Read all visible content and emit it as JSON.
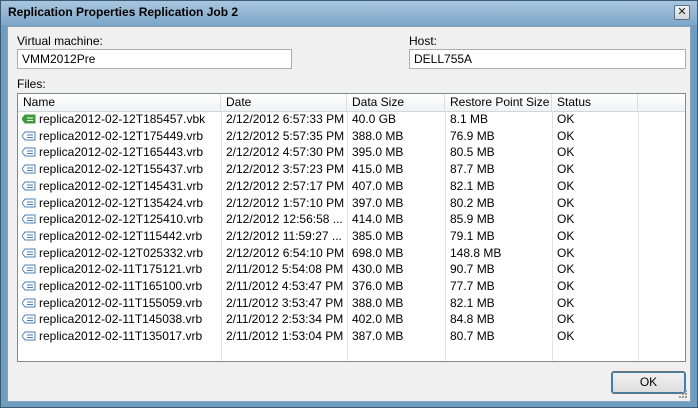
{
  "window": {
    "title": "Replication Properties Replication Job 2",
    "close_glyph": "✕"
  },
  "form": {
    "vm_label": "Virtual machine:",
    "vm_value": "VMM2012Pre",
    "host_label": "Host:",
    "host_value": "DELL755A",
    "files_label": "Files:"
  },
  "table": {
    "columns": [
      "Name",
      "Date",
      "Data Size",
      "Restore Point Size",
      "Status"
    ],
    "rows": [
      {
        "name": "replica2012-02-12T185457.vbk",
        "date": "2/12/2012 6:57:33 PM",
        "size": "40.0 GB",
        "rp": "8.1 MB",
        "status": "OK",
        "icon": "full-backup-icon"
      },
      {
        "name": "replica2012-02-12T175449.vrb",
        "date": "2/12/2012 5:57:35 PM",
        "size": "388.0 MB",
        "rp": "76.9 MB",
        "status": "OK",
        "icon": "rollback-file-icon"
      },
      {
        "name": "replica2012-02-12T165443.vrb",
        "date": "2/12/2012 4:57:30 PM",
        "size": "395.0 MB",
        "rp": "80.5 MB",
        "status": "OK",
        "icon": "rollback-file-icon"
      },
      {
        "name": "replica2012-02-12T155437.vrb",
        "date": "2/12/2012 3:57:23 PM",
        "size": "415.0 MB",
        "rp": "87.7 MB",
        "status": "OK",
        "icon": "rollback-file-icon"
      },
      {
        "name": "replica2012-02-12T145431.vrb",
        "date": "2/12/2012 2:57:17 PM",
        "size": "407.0 MB",
        "rp": "82.1 MB",
        "status": "OK",
        "icon": "rollback-file-icon"
      },
      {
        "name": "replica2012-02-12T135424.vrb",
        "date": "2/12/2012 1:57:10 PM",
        "size": "397.0 MB",
        "rp": "80.2 MB",
        "status": "OK",
        "icon": "rollback-file-icon"
      },
      {
        "name": "replica2012-02-12T125410.vrb",
        "date": "2/12/2012 12:56:58 ...",
        "size": "414.0 MB",
        "rp": "85.9 MB",
        "status": "OK",
        "icon": "rollback-file-icon"
      },
      {
        "name": "replica2012-02-12T115442.vrb",
        "date": "2/12/2012 11:59:27 ...",
        "size": "385.0 MB",
        "rp": "79.1 MB",
        "status": "OK",
        "icon": "rollback-file-icon"
      },
      {
        "name": "replica2012-02-12T025332.vrb",
        "date": "2/12/2012 6:54:10 PM",
        "size": "698.0 MB",
        "rp": "148.8 MB",
        "status": "OK",
        "icon": "rollback-file-icon"
      },
      {
        "name": "replica2012-02-11T175121.vrb",
        "date": "2/11/2012 5:54:08 PM",
        "size": "430.0 MB",
        "rp": "90.7 MB",
        "status": "OK",
        "icon": "rollback-file-icon"
      },
      {
        "name": "replica2012-02-11T165100.vrb",
        "date": "2/11/2012 4:53:47 PM",
        "size": "376.0 MB",
        "rp": "77.7 MB",
        "status": "OK",
        "icon": "rollback-file-icon"
      },
      {
        "name": "replica2012-02-11T155059.vrb",
        "date": "2/11/2012 3:53:47 PM",
        "size": "388.0 MB",
        "rp": "82.1 MB",
        "status": "OK",
        "icon": "rollback-file-icon"
      },
      {
        "name": "replica2012-02-11T145038.vrb",
        "date": "2/11/2012 2:53:34 PM",
        "size": "402.0 MB",
        "rp": "84.8 MB",
        "status": "OK",
        "icon": "rollback-file-icon"
      },
      {
        "name": "replica2012-02-11T135017.vrb",
        "date": "2/11/2012 1:53:04 PM",
        "size": "387.0 MB",
        "rp": "80.7 MB",
        "status": "OK",
        "icon": "rollback-file-icon"
      }
    ]
  },
  "buttons": {
    "ok_label": "OK"
  },
  "colors": {
    "titlebar": "#7ea7c8",
    "dialog_bg": "#f0f0f0",
    "full_backup_icon": "#3f9b3a",
    "rollback_icon": "#4a7fb5"
  }
}
